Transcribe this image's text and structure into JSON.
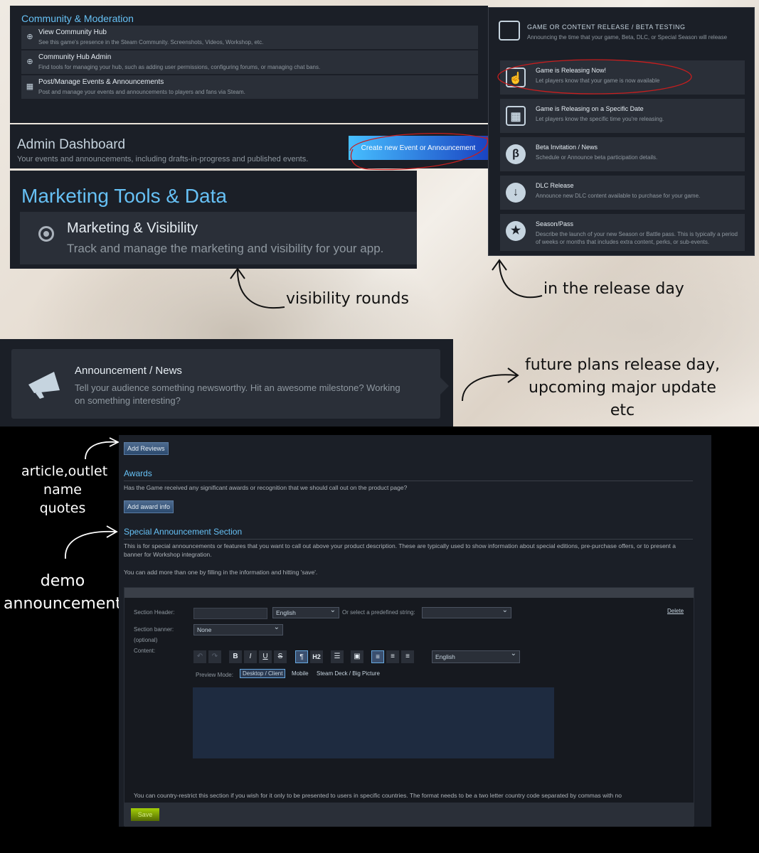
{
  "community": {
    "title": "Community & Moderation",
    "items": [
      {
        "icon": "globe-icon",
        "title": "View Community Hub",
        "desc": "See this game's presence in the Steam Community. Screenshots, Videos, Workshop, etc."
      },
      {
        "icon": "globe-icon",
        "title": "Community Hub Admin",
        "desc": "Find tools for managing your hub, such as adding user permissions, configuring forums, or managing chat bans."
      },
      {
        "icon": "calendar-icon",
        "title": "Post/Manage Events & Announcements",
        "desc": "Post and manage your events and announcements to players and fans via Steam."
      }
    ]
  },
  "admin": {
    "title": "Admin Dashboard",
    "desc": "Your events and announcements, including drafts-in-progress and published events.",
    "create_label": "Create new Event or Announcement"
  },
  "marketing": {
    "title": "Marketing Tools & Data",
    "item_title": "Marketing & Visibility",
    "item_desc": "Track and manage the marketing and visibility for your app."
  },
  "release": {
    "title": "GAME OR CONTENT RELEASE / BETA TESTING",
    "desc": "Announcing the time that your game, Beta, DLC, or Special Season will release",
    "options": [
      {
        "icon": "pointer-icon",
        "title": "Game is Releasing Now!",
        "desc": "Let players know that your game is now available"
      },
      {
        "icon": "calendar-icon",
        "title": "Game is Releasing on a Specific Date",
        "desc": "Let players know the specific time you're releasing."
      },
      {
        "icon": "beta-icon",
        "title": "Beta Invitation / News",
        "desc": "Schedule or Announce beta participation details."
      },
      {
        "icon": "download-icon",
        "title": "DLC Release",
        "desc": "Announce new DLC content available to purchase for your game."
      },
      {
        "icon": "shield-star-icon",
        "title": "Season/Pass",
        "desc": "Describe the launch of your new Season or Battle pass. This is typically a period of weeks or months that includes extra content, perks, or sub-events."
      }
    ]
  },
  "notes": {
    "visibility": "visibility rounds",
    "release_day": "in the release day",
    "future": [
      "future plans release day,",
      "upcoming major update",
      "etc"
    ],
    "article": [
      "article,outlet",
      "name quotes"
    ],
    "demo": [
      "demo",
      "announcement"
    ]
  },
  "announcement": {
    "title": "Announcement / News",
    "desc": "Tell your audience something newsworthy. Hit an awesome milestone? Working on something interesting?"
  },
  "store": {
    "add_reviews": "Add Reviews",
    "awards_title": "Awards",
    "awards_desc": "Has the Game received any significant awards or recognition that we should call out on the product page?",
    "add_award": "Add award info",
    "special_title": "Special Announcement Section",
    "special_desc": "This is for special announcements or features that you want to call out above your product description. These are typically used to show information about special editions, pre-purchase offers, or to present a banner for Workshop integration.",
    "special_note": "You can add more than one by filling in the information and hitting 'save'.",
    "section_header_label": "Section Header:",
    "section_header_value": "",
    "language": "English",
    "predefined_label": "Or select a predefined string:",
    "predefined_value": "",
    "delete": "Delete",
    "banner_label": "Section banner:",
    "optional": "(optional)",
    "banner_value": "None",
    "content_label": "Content:",
    "editor_language": "English",
    "preview_label": "Preview Mode:",
    "preview_modes": [
      "Desktop / Client",
      "Mobile",
      "Steam Deck / Big Picture"
    ],
    "country_note": "You can country-restrict this section if you wish for it only to be presented to users in specific countries. The format needs to be a two letter country code separated by commas with no",
    "save": "Save"
  }
}
